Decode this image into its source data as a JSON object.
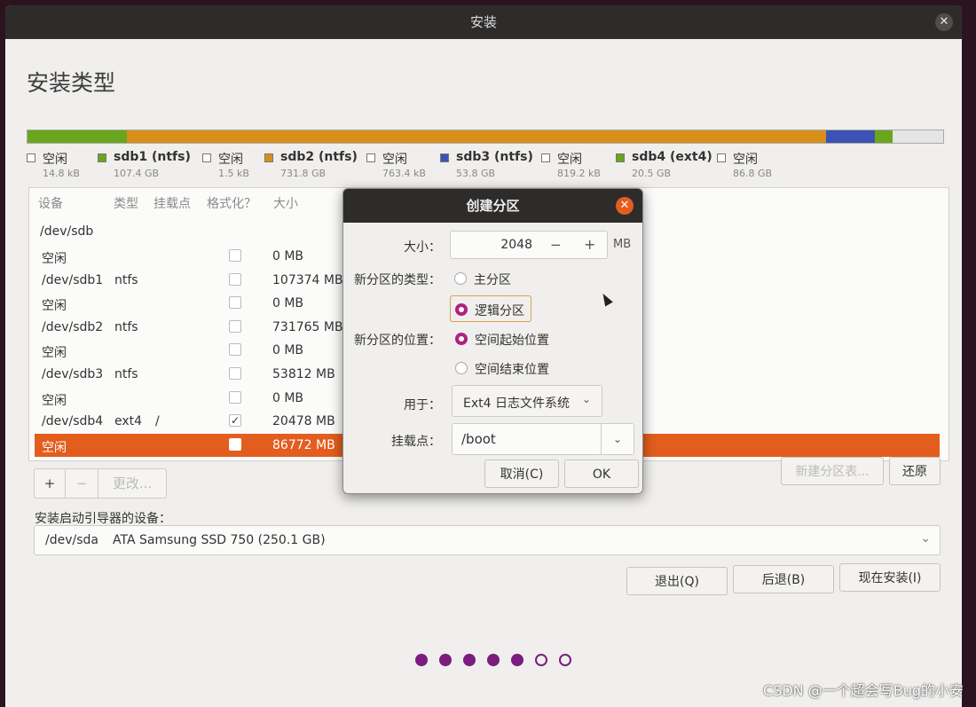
{
  "window": {
    "title": "安装",
    "close_icon": "✕"
  },
  "page_title": "安装类型",
  "partition_bar": [
    {
      "color": "#6aa51e",
      "width_pct": 1.4
    },
    {
      "color": "#6aa51e",
      "width_pct": 9.5
    },
    {
      "color": "#d6901a",
      "width_pct": 76.3
    },
    {
      "color": "#3d52b4",
      "width_pct": 5.3
    },
    {
      "color": "#6aa51e",
      "width_pct": 2.0
    },
    {
      "color": "#e5e5e5",
      "width_pct": 5.5
    }
  ],
  "legend": [
    {
      "name": "空闲",
      "size": "14.8 kB",
      "color": "#ffffff",
      "bold": false
    },
    {
      "name": "sdb1 (ntfs)",
      "size": "107.4 GB",
      "color": "#6aa51e",
      "bold": true
    },
    {
      "name": "空闲",
      "size": "1.5 kB",
      "color": "#ffffff",
      "bold": false
    },
    {
      "name": "sdb2 (ntfs)",
      "size": "731.8 GB",
      "color": "#d6901a",
      "bold": true
    },
    {
      "name": "空闲",
      "size": "763.4 kB",
      "color": "#ffffff",
      "bold": false
    },
    {
      "name": "sdb3 (ntfs)",
      "size": "53.8 GB",
      "color": "#3d52b4",
      "bold": true
    },
    {
      "name": "空闲",
      "size": "819.2 kB",
      "color": "#ffffff",
      "bold": false
    },
    {
      "name": "sdb4 (ext4)",
      "size": "20.5 GB",
      "color": "#6aa51e",
      "bold": true
    },
    {
      "name": "空闲",
      "size": "86.8 GB",
      "color": "#ffffff",
      "bold": false
    }
  ],
  "table": {
    "headers": {
      "device": "设备",
      "type": "类型",
      "mount": "挂载点",
      "format": "格式化？",
      "size": "大小"
    },
    "disk": "/dev/sdb",
    "rows": [
      {
        "device": "空闲",
        "type": "",
        "mount": "",
        "format": "",
        "size": "0 MB"
      },
      {
        "device": "/dev/sdb1",
        "type": "ntfs",
        "mount": "",
        "format": "",
        "size": "107374 MB"
      },
      {
        "device": "空闲",
        "type": "",
        "mount": "",
        "format": "",
        "size": "0 MB"
      },
      {
        "device": "/dev/sdb2",
        "type": "ntfs",
        "mount": "",
        "format": "",
        "size": "731765 MB"
      },
      {
        "device": "空闲",
        "type": "",
        "mount": "",
        "format": "",
        "size": "0 MB"
      },
      {
        "device": "/dev/sdb3",
        "type": "ntfs",
        "mount": "",
        "format": "",
        "size": "53812 MB"
      },
      {
        "device": "空闲",
        "type": "",
        "mount": "",
        "format": "",
        "size": "0 MB"
      },
      {
        "device": "/dev/sdb4",
        "type": "ext4",
        "mount": "/",
        "format": "✓",
        "size": "20478 MB"
      },
      {
        "device": "空闲",
        "type": "",
        "mount": "",
        "format": "",
        "size": "86772 MB"
      }
    ]
  },
  "tools": {
    "add": "+",
    "remove": "−",
    "change": "更改..."
  },
  "new_table_button": "新建分区表...",
  "revert_button": "还原",
  "boot_loader": {
    "label": "安装启动引导器的设备：",
    "device": "/dev/sda",
    "description": "ATA Samsung SSD 750 (250.1 GB)",
    "chevron_icon": "⌄"
  },
  "footer": {
    "quit": "退出(Q)",
    "back": "后退(B)",
    "install": "现在安装(I)"
  },
  "progress_dots": {
    "filled": 5,
    "total": 7
  },
  "dialog": {
    "title": "创建分区",
    "close_icon": "✕",
    "size_label": "大小：",
    "size_value": "2048",
    "minus": "−",
    "plus": "+",
    "unit": "MB",
    "type_label": "新分区的类型：",
    "type_primary": "主分区",
    "type_logical": "逻辑分区",
    "location_label": "新分区的位置：",
    "location_start": "空间起始位置",
    "location_end": "空间结束位置",
    "use_label": "用于：",
    "use_value": "Ext4 日志文件系统",
    "mount_label": "挂载点：",
    "mount_value": "/boot",
    "cancel": "取消(C)",
    "ok": "OK"
  },
  "watermark": "CSDN @一个超会写Bug的小安"
}
